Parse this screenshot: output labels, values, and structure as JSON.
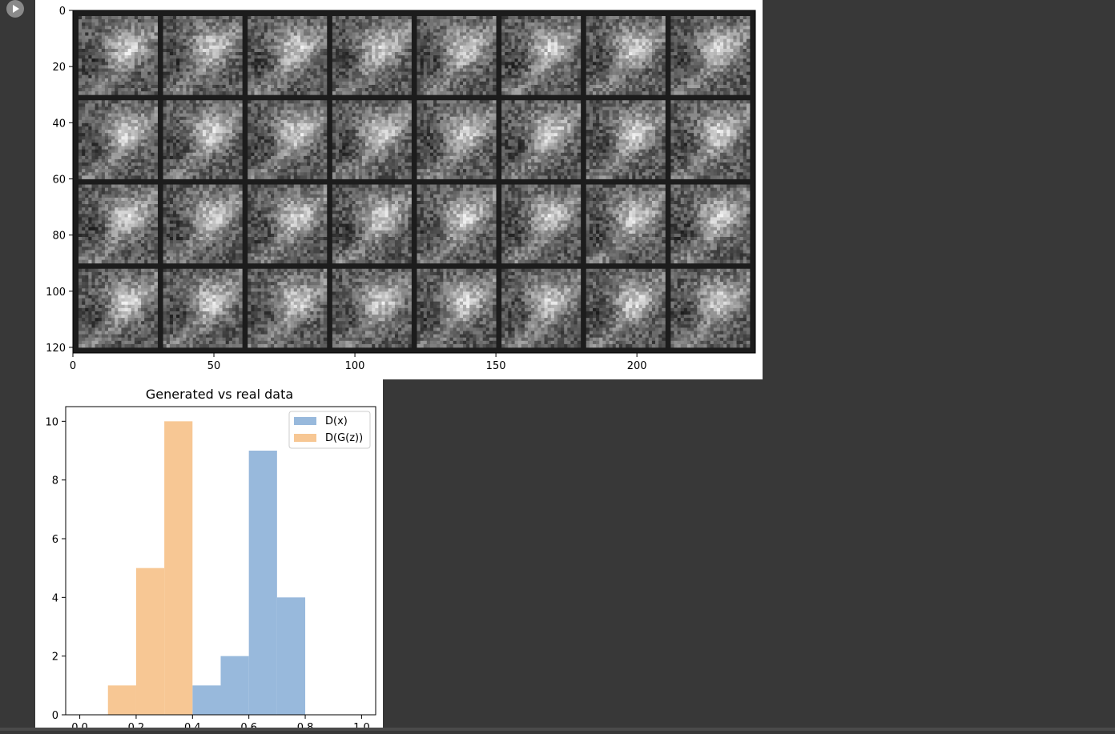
{
  "cell": {
    "run_icon": "play-circle-icon"
  },
  "colors": {
    "background": "#383838",
    "grid_border": "#1c1c1c",
    "dx": "#7ea8d3",
    "dgz": "#f5b979"
  },
  "image_grid": {
    "rows": 4,
    "cols": 8,
    "x_ticks": [
      0,
      50,
      100,
      150,
      200
    ],
    "y_ticks": [
      0,
      20,
      40,
      60,
      80,
      100,
      120
    ],
    "xlim": [
      0,
      242
    ],
    "ylim": [
      122,
      0
    ]
  },
  "chart_data": {
    "type": "bar",
    "title": "Generated vs real data",
    "xlabel": "",
    "ylabel": "",
    "xlim": [
      -0.05,
      1.05
    ],
    "ylim": [
      0,
      10.5
    ],
    "x_ticks": [
      "0.0",
      "0.2",
      "0.4",
      "0.6",
      "0.8",
      "1.0"
    ],
    "y_ticks": [
      0,
      2,
      4,
      6,
      8,
      10
    ],
    "bin_edges": [
      0.0,
      0.1,
      0.2,
      0.3,
      0.4,
      0.5,
      0.6,
      0.7,
      0.8,
      0.9,
      1.0
    ],
    "legend_position": "top-right",
    "series": [
      {
        "name": "D(x)",
        "counts": [
          0,
          0,
          0,
          0,
          1,
          2,
          9,
          4,
          0,
          0
        ]
      },
      {
        "name": "D(G(z))",
        "counts": [
          0,
          1,
          5,
          10,
          0,
          0,
          0,
          0,
          0,
          0
        ]
      }
    ]
  }
}
